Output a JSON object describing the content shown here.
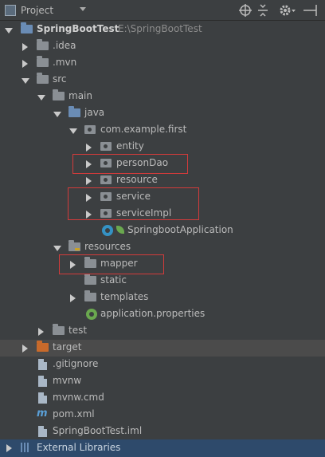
{
  "toolbar": {
    "title": "Project",
    "icons": [
      "dropdown-caret",
      "locate-icon",
      "collapse-icon",
      "gear-icon",
      "hide-icon"
    ]
  },
  "tree": {
    "root_label": "SpringBootTest",
    "root_path": "E:\\SpringBootTest",
    "items": [
      {
        "label": ".idea"
      },
      {
        "label": ".mvn"
      },
      {
        "label": "src"
      },
      {
        "label": "main"
      },
      {
        "label": "java"
      },
      {
        "label": "com.example.first"
      },
      {
        "label": "entity"
      },
      {
        "label": "personDao"
      },
      {
        "label": "resource"
      },
      {
        "label": "service"
      },
      {
        "label": "serviceImpl"
      },
      {
        "label": "SpringbootApplication"
      },
      {
        "label": "resources"
      },
      {
        "label": "mapper"
      },
      {
        "label": "static"
      },
      {
        "label": "templates"
      },
      {
        "label": "application.properties"
      },
      {
        "label": "test"
      },
      {
        "label": "target"
      },
      {
        "label": ".gitignore"
      },
      {
        "label": "mvnw"
      },
      {
        "label": "mvnw.cmd"
      },
      {
        "label": "pom.xml"
      },
      {
        "label": "SpringBootTest.iml"
      }
    ]
  },
  "external_libraries": "External Libraries",
  "colors": {
    "background": "#3c3f41",
    "text": "#bbbbbb",
    "highlight_box": "#d33b3b",
    "external_libraries_bar": "#2e4a6b"
  }
}
